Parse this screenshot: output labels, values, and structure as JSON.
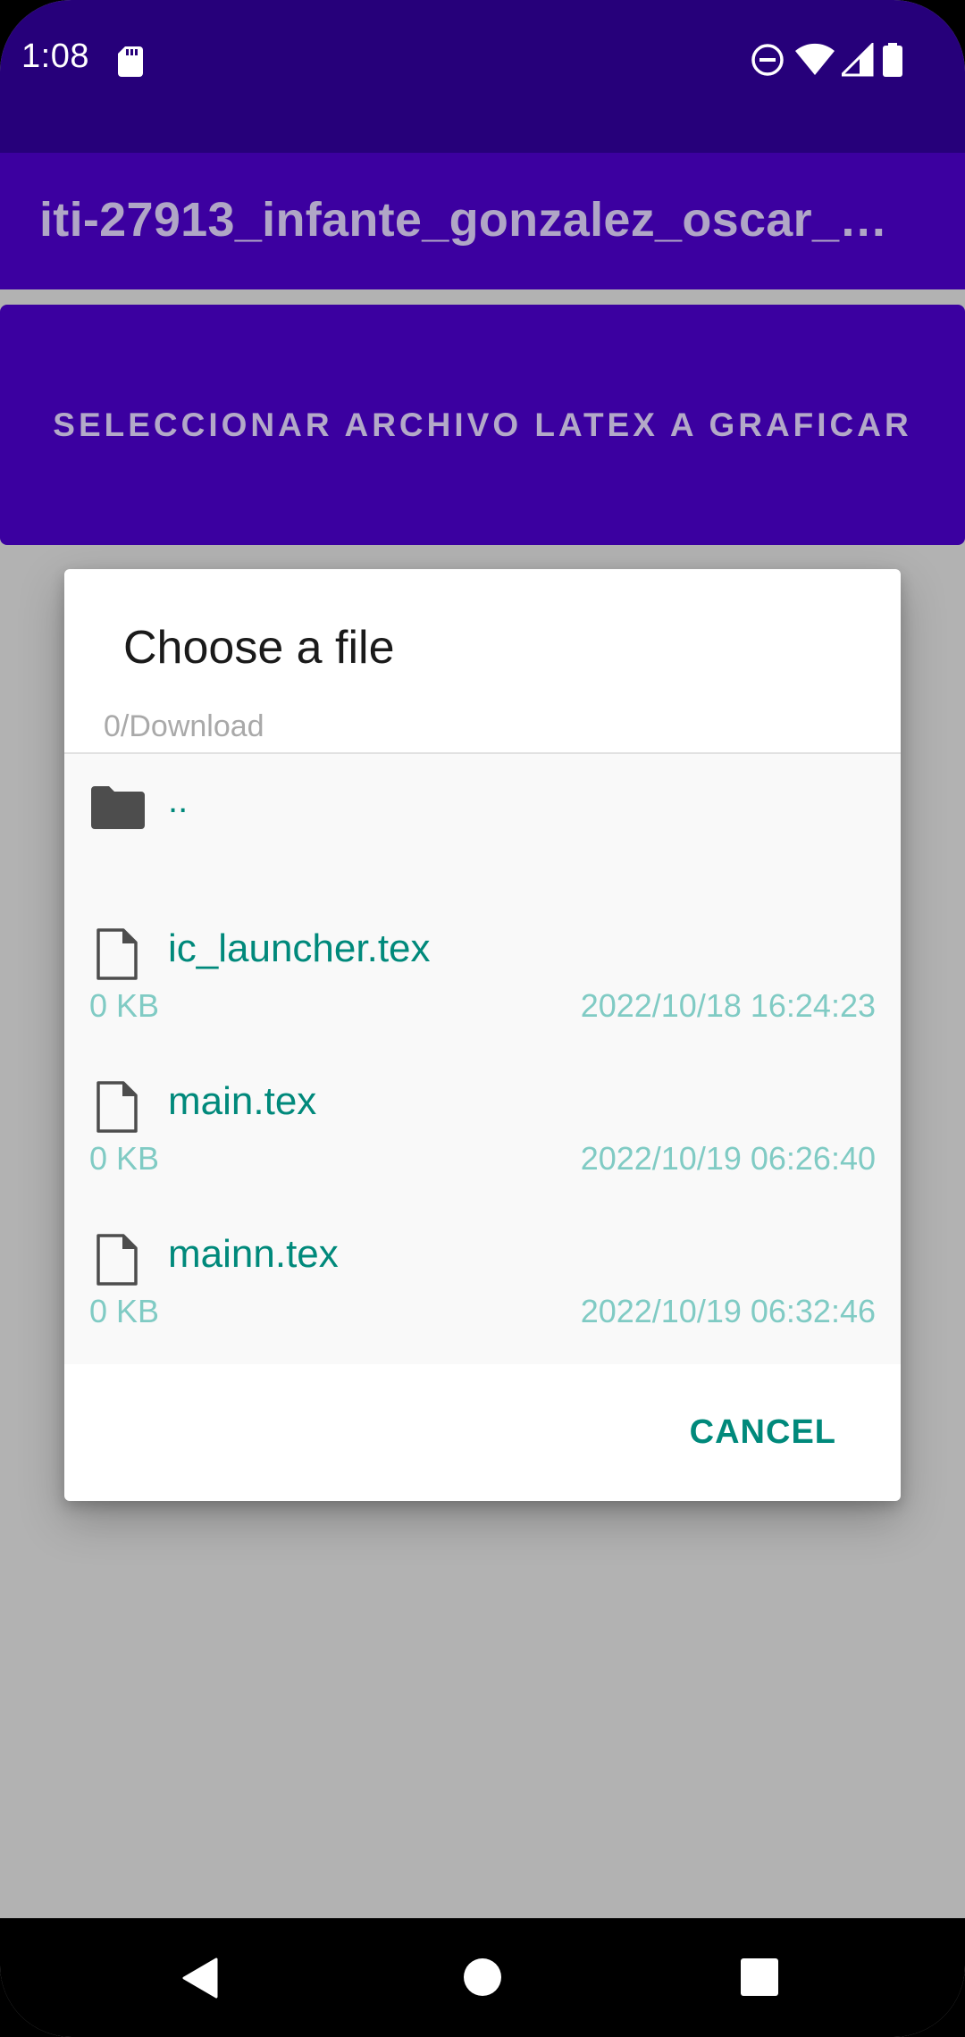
{
  "status_bar": {
    "time": "1:08",
    "icons": [
      "sd-card-icon",
      "do-not-disturb-icon",
      "wifi-icon",
      "signal-icon",
      "battery-icon"
    ]
  },
  "app_bar": {
    "title": "iti-27913_infante_gonzalez_oscar_e…"
  },
  "main": {
    "select_button_label": "SELECCIONAR ARCHIVO LATEX A GRAFICAR"
  },
  "dialog": {
    "title": "Choose a file",
    "path": "0/Download",
    "parent_label": "..",
    "files": [
      {
        "name": "ic_launcher.tex",
        "size": "0 KB",
        "date": "2022/10/18 16:24:23"
      },
      {
        "name": "main.tex",
        "size": "0 KB",
        "date": "2022/10/19 06:26:40"
      },
      {
        "name": "mainn.tex",
        "size": "0 KB",
        "date": "2022/10/19 06:32:46"
      }
    ],
    "cancel_label": "CANCEL"
  },
  "colors": {
    "status_bar": "#26007a",
    "app_bar": "#3c00a0",
    "scrim": "#b2b2b2",
    "accent": "#00897b",
    "accent_light": "#80cbc4"
  }
}
